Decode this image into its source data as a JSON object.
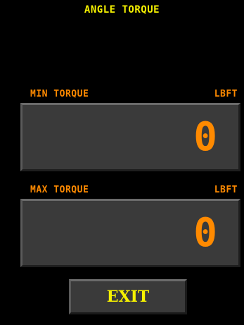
{
  "screen": {
    "title": "ANGLE TORQUE"
  },
  "min_torque": {
    "label": "MIN TORQUE",
    "unit": "LBFT",
    "value": "0"
  },
  "max_torque": {
    "label": "MAX TORQUE",
    "unit": "LBFT",
    "value": "0"
  },
  "exit_button": {
    "label": "EXIT"
  },
  "colors": {
    "title": "#f6f200",
    "label": "#ff8a00",
    "value": "#ff8a00",
    "panel": "#3a3a3a",
    "background": "#000000"
  }
}
